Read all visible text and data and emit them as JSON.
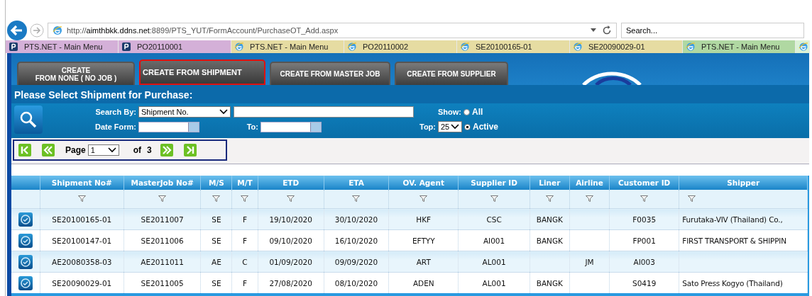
{
  "browser": {
    "url": "http://**aimthbkk.ddns.net**:8899/PTS_YUT/FormAccount/PurchaseOT_Add.aspx",
    "search_placeholder": "Search..."
  },
  "tabs": [
    {
      "label": "PTS.NET - Main Menu",
      "kind": "app",
      "color": "#d4b0d8"
    },
    {
      "label": "PO20110001",
      "kind": "app",
      "color": "#d4b0d8"
    },
    {
      "label": "PTS.NET - Main Menu",
      "kind": "browser",
      "color": "#e6dca2"
    },
    {
      "label": "PO20110002",
      "kind": "browser",
      "color": "#e6dca2"
    },
    {
      "label": "SE20100165-01",
      "kind": "browser",
      "color": "#e6dca2"
    },
    {
      "label": "SE20090029-01",
      "kind": "browser",
      "color": "#e6dca2"
    },
    {
      "label": "PTS.NET - Main Menu",
      "kind": "browser",
      "color": "#b0d8a2"
    },
    {
      "kind": "browser",
      "color": "#dcf2d6"
    }
  ],
  "actions": [
    {
      "label": "CREATE\nFROM  NONE ( NO JOB )",
      "selected": false
    },
    {
      "label": "CREATE FROM SHIPMENT",
      "selected": true
    },
    {
      "label": "CREATE FROM MASTER JOB",
      "selected": false
    },
    {
      "label": "CREATE  FROM  SUPPLIER",
      "selected": false
    }
  ],
  "panel": {
    "title": "Please Select Shipment for Purchase:",
    "search": {
      "search_by_label": "Search By:",
      "search_by_value": "Shipment No.",
      "date_from_label": "Date Form:",
      "to_label": "To:",
      "show_label": "Show:",
      "top_label": "Top:",
      "top_value": "25",
      "show_options": [
        {
          "label": "All",
          "selected": false
        },
        {
          "label": "Active",
          "selected": true
        }
      ]
    },
    "pager": {
      "page_label": "Page",
      "page_value": "1",
      "of_label": "of",
      "total": "3"
    }
  },
  "table": {
    "columns": [
      "Shipment No#",
      "MasterJob No#",
      "M/S",
      "M/T",
      "ETD",
      "ETA",
      "OV. Agent",
      "Supplier ID",
      "Liner",
      "Airline",
      "Customer ID",
      "Shipper"
    ],
    "rows": [
      [
        "SE20100165-01",
        "SE2011007",
        "SE",
        "F",
        "19/10/2020",
        "30/10/2020",
        "HKF",
        "CSC",
        "BANGK",
        null,
        "F0035",
        "Furutaka-VIV (Thailand) Co.,"
      ],
      [
        "SE20100147-01",
        "SE2011006",
        "SE",
        "F",
        "09/10/2020",
        "16/10/2020",
        "EFTYY",
        "AI001",
        "BANGK",
        null,
        "FP001",
        "FIRST TRANSPORT & SHIPPIN"
      ],
      [
        "AE20080358-03",
        "AE2011011",
        "AE",
        "C",
        "01/09/2020",
        "09/09/2020",
        "ART",
        "AL001",
        null,
        "JM",
        "AI003",
        null
      ],
      [
        "SE20090029-01",
        "SE2011005",
        "SE",
        "F",
        "27/08/2020",
        "08/10/2020",
        "ADEN",
        "AL001",
        "BANGK",
        null,
        "S0419",
        "Sato Press Kogyo (Thailand)"
      ]
    ]
  }
}
